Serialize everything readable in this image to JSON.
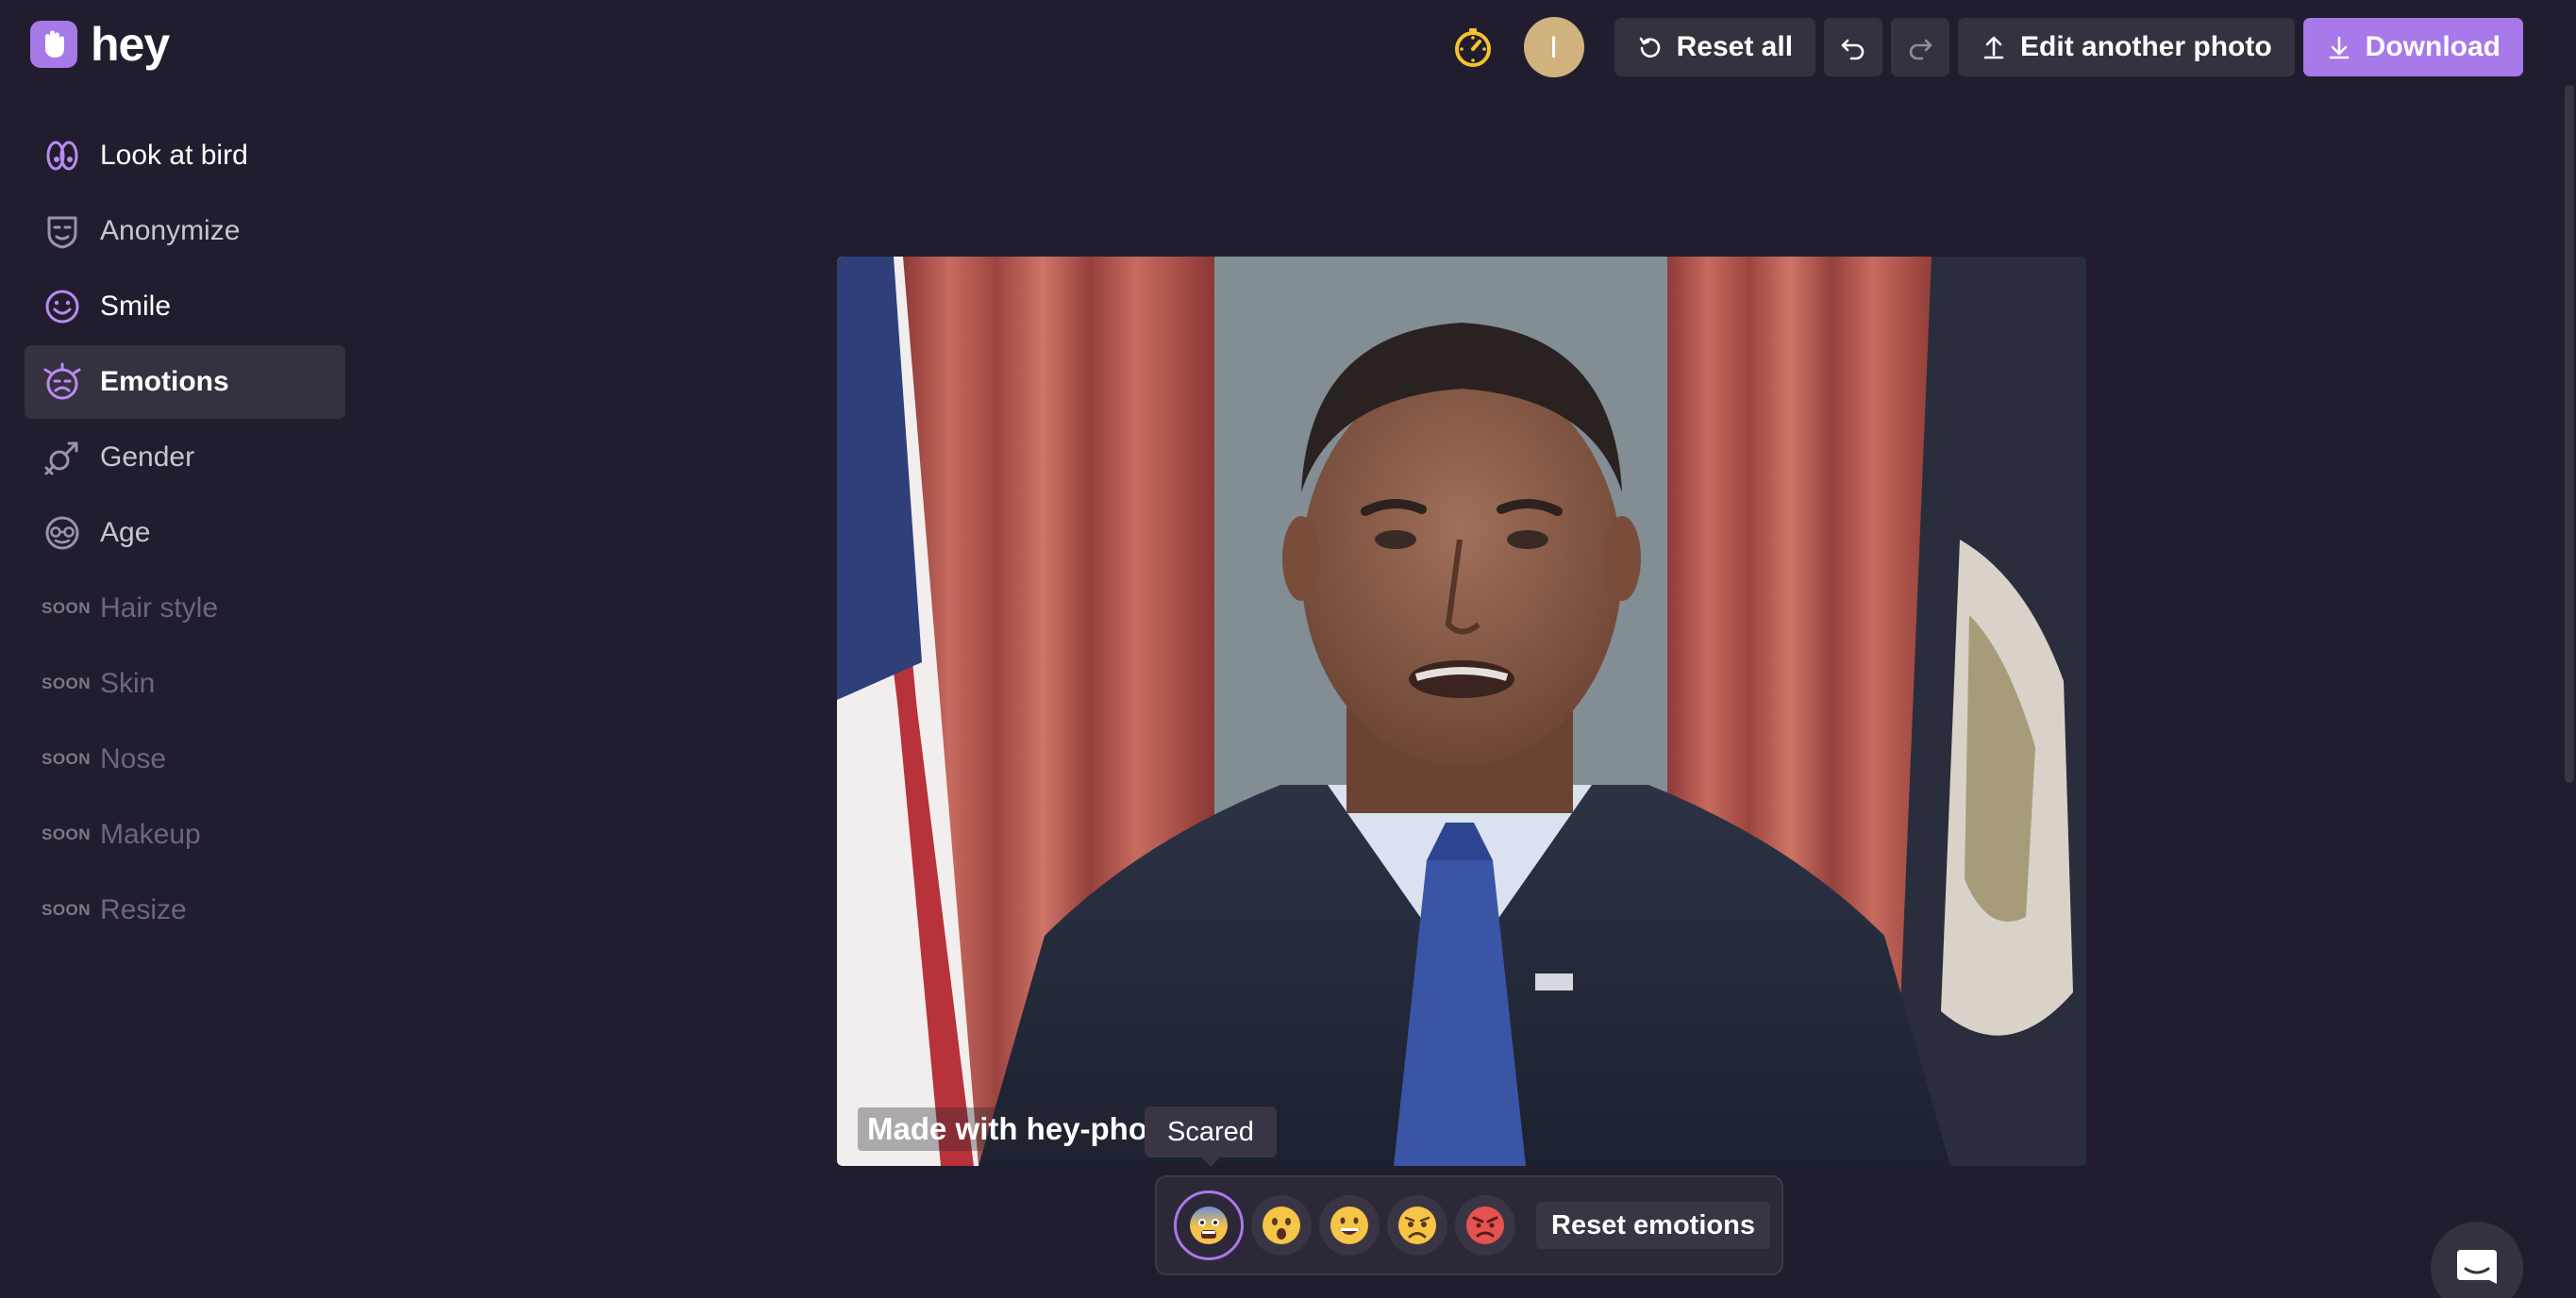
{
  "app": {
    "logo_hey": "hey",
    "logo_photo": "photo"
  },
  "header": {
    "avatar_initial": "I",
    "reset_all": "Reset all",
    "edit_another": "Edit another photo",
    "download": "Download"
  },
  "sidebar": {
    "items": [
      {
        "label": "Look at bird",
        "icon": "eyes-icon"
      },
      {
        "label": "Anonymize",
        "icon": "mask-icon"
      },
      {
        "label": "Smile",
        "icon": "smile-icon"
      },
      {
        "label": "Emotions",
        "icon": "emotions-face-icon",
        "active": true
      },
      {
        "label": "Gender",
        "icon": "gender-icon"
      },
      {
        "label": "Age",
        "icon": "old-face-icon"
      }
    ],
    "soon_tag": "SOON",
    "soon_items": [
      "Hair style",
      "Skin",
      "Nose",
      "Makeup",
      "Resize"
    ]
  },
  "canvas": {
    "watermark": "Made with hey-pho",
    "tooltip": "Scared",
    "emotions": [
      {
        "icon": "scared-emoji-icon",
        "selected": true
      },
      {
        "icon": "surprised-emoji-icon"
      },
      {
        "icon": "happy-emoji-icon"
      },
      {
        "icon": "sad-emoji-icon"
      },
      {
        "icon": "angry-emoji-icon"
      }
    ],
    "reset_emotions": "Reset emotions"
  },
  "colors": {
    "background": "#221d2e",
    "surface": "#36313f",
    "accent": "#a779e9",
    "avatar": "#cfb27e",
    "timer": "#f2c230"
  }
}
